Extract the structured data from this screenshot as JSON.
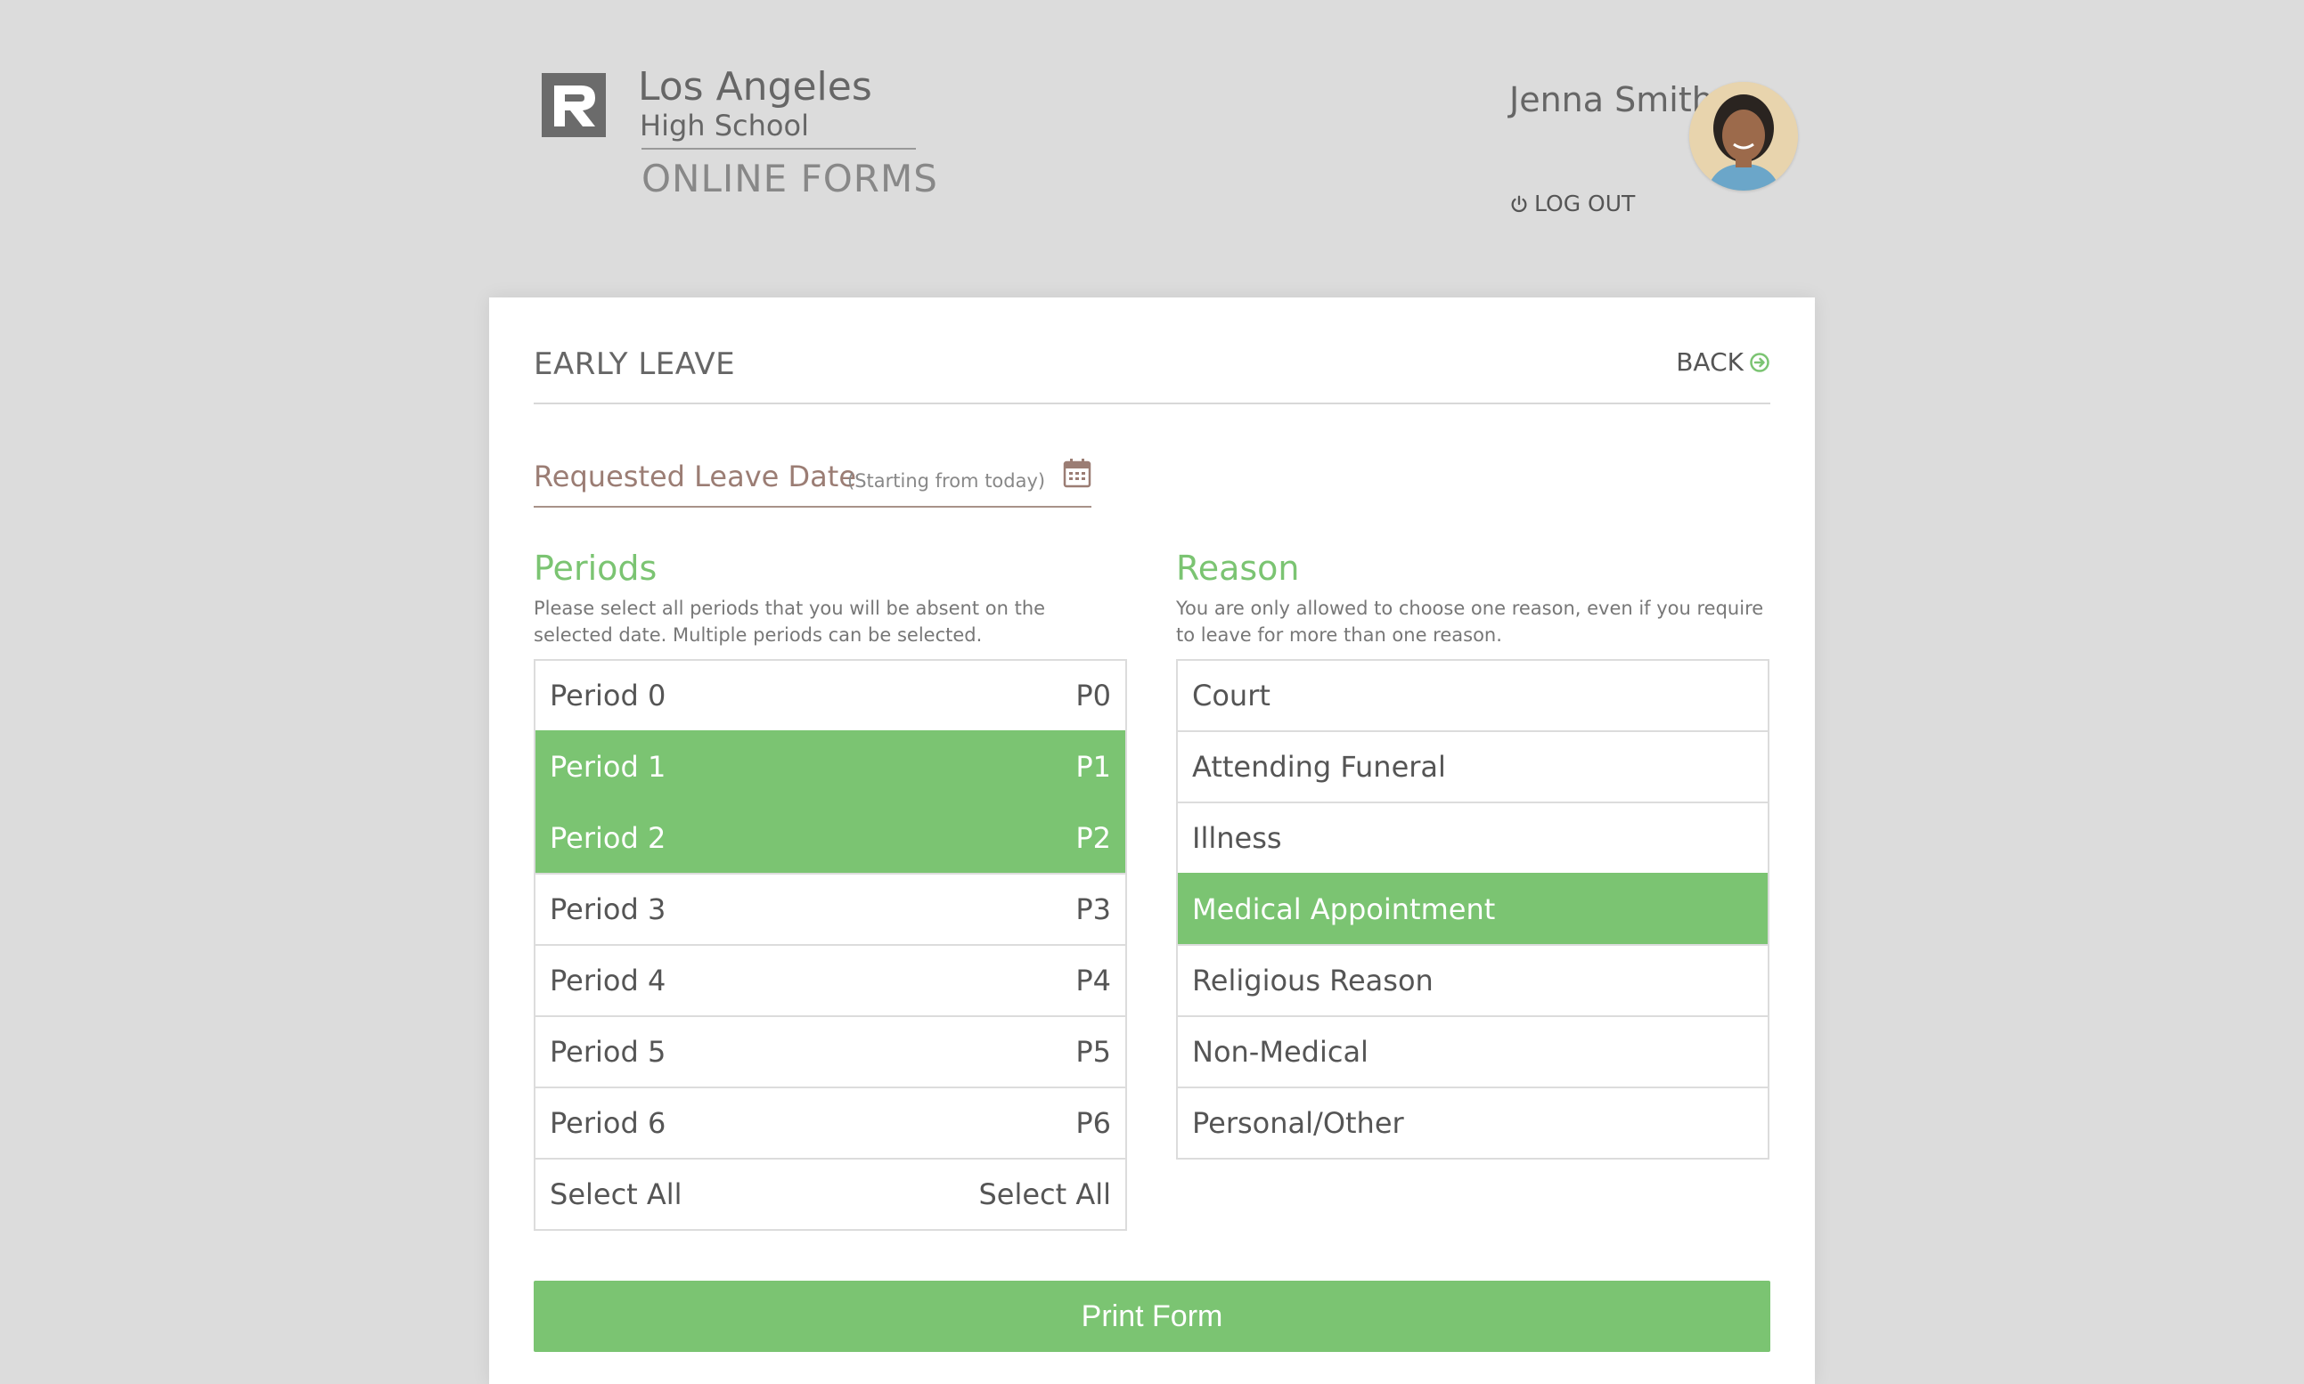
{
  "header": {
    "school_name": "Los Angeles",
    "school_sub": "High School",
    "app_name": "ONLINE FORMS",
    "user_name": "Jenna Smith",
    "logout_label": "LOG OUT"
  },
  "form": {
    "title": "EARLY LEAVE",
    "back_label": "BACK",
    "date_label": "Requested Leave Date",
    "date_hint": "(Starting from today)",
    "periods": {
      "title": "Periods",
      "description": "Please select all periods that you will be absent on the selected date. Multiple periods can be selected.",
      "items": [
        {
          "label": "Period 0",
          "code": "P0",
          "selected": false
        },
        {
          "label": "Period 1",
          "code": "P1",
          "selected": true
        },
        {
          "label": "Period 2",
          "code": "P2",
          "selected": true
        },
        {
          "label": "Period 3",
          "code": "P3",
          "selected": false
        },
        {
          "label": "Period 4",
          "code": "P4",
          "selected": false
        },
        {
          "label": "Period 5",
          "code": "P5",
          "selected": false
        },
        {
          "label": "Period 6",
          "code": "P6",
          "selected": false
        },
        {
          "label": "Select All",
          "code": "Select All",
          "selected": false
        }
      ]
    },
    "reason": {
      "title": "Reason",
      "description": "You are only allowed to choose one reason, even if you require to leave for more than one reason.",
      "items": [
        {
          "label": "Court",
          "selected": false
        },
        {
          "label": "Attending Funeral",
          "selected": false
        },
        {
          "label": "Illness",
          "selected": false
        },
        {
          "label": "Medical Appointment",
          "selected": true
        },
        {
          "label": "Religious Reason",
          "selected": false
        },
        {
          "label": "Non-Medical",
          "selected": false
        },
        {
          "label": "Personal/Other",
          "selected": false
        }
      ]
    },
    "print_label": "Print Form"
  },
  "colors": {
    "accent": "#7bc472",
    "background": "#dcdcdc",
    "date_label": "#9b7d74"
  },
  "icons": {
    "logo": "school-logo-icon",
    "logout": "power-icon",
    "back": "arrow-circle-right-icon",
    "calendar": "calendar-icon"
  }
}
